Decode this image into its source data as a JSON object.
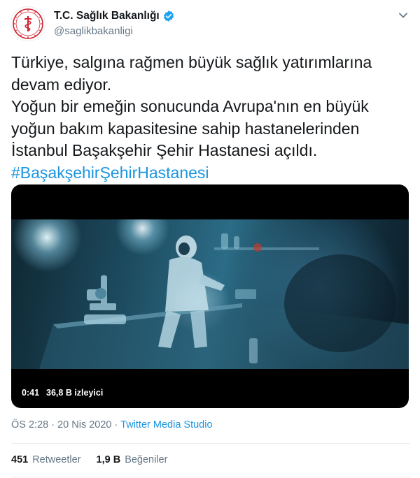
{
  "account": {
    "display_name": "T.C. Sağlık Bakanlığı",
    "handle": "@saglikbakanligi",
    "verified": true,
    "avatar_icon": "ministry-of-health-logo"
  },
  "tweet": {
    "lines": [
      "Türkiye, salgına rağmen büyük sağlık yatırımlarına",
      "devam ediyor.",
      "Yoğun bir emeğin sonucunda Avrupa'nın en büyük",
      "yoğun bakım kapasitesine sahip hastanelerinden",
      "İstanbul Başakşehir Şehir Hastanesi açıldı."
    ],
    "hashtag": "#BaşakşehirŞehirHastanesi"
  },
  "video": {
    "duration": "0:41",
    "views": "36,8 B izleyici"
  },
  "meta": {
    "time": "ÖS 2:28",
    "separator": "·",
    "date": "20 Nis 2020",
    "source": "Twitter Media Studio"
  },
  "stats": {
    "retweets_count": "451",
    "retweets_label": "Retweetler",
    "likes_count": "1,9 B",
    "likes_label": "Beğeniler"
  },
  "colors": {
    "link": "#1b95e0",
    "text": "#14171a",
    "secondary": "#657786",
    "logo_red": "#d0202e",
    "divider": "#e6ecf0"
  }
}
